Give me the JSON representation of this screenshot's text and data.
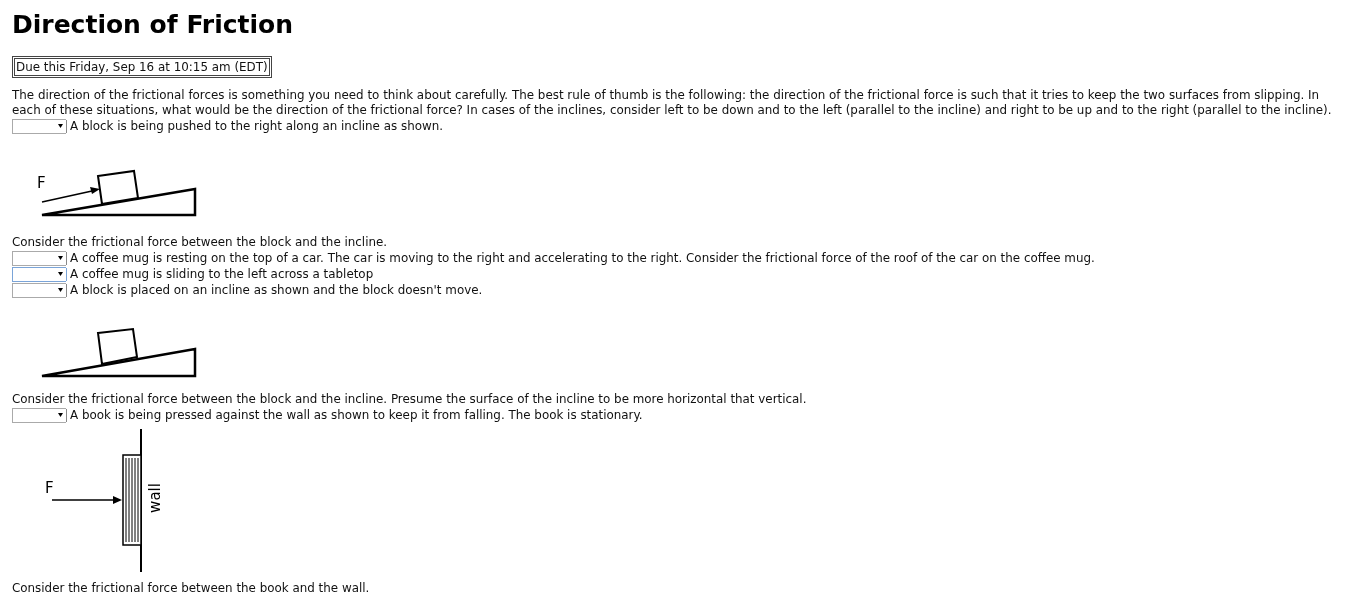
{
  "title": "Direction of Friction",
  "due": "Due this Friday, Sep 16 at 10:15 am (EDT)",
  "intro": "The direction of the frictional forces is something you need to think about carefully. The best rule of thumb is the following: the direction of the frictional force is such that it tries to keep the two surfaces from slipping. In each of these situations, what would be the direction of the frictional force? In cases of the inclines, consider left to be down and to the left (parallel to the incline) and right to be up and to the right (parallel to the incline).",
  "questions": [
    {
      "text": "A block is being pushed to the right along an incline as shown.",
      "focused": false,
      "figure": {
        "kind": "incline_push",
        "labels": [
          "F"
        ]
      },
      "note": "Consider the frictional force between the block and the incline."
    },
    {
      "text": "A coffee mug is resting on the top of a car. The car is moving to the right and accelerating to the right. Consider the frictional force of the roof of the car on the coffee mug.",
      "focused": false
    },
    {
      "text": "A coffee mug is sliding to the left across a tabletop",
      "focused": true
    },
    {
      "text": "A block is placed on an incline as shown and the block doesn't move.",
      "focused": false,
      "figure": {
        "kind": "incline_rest"
      },
      "note": "Consider the frictional force between the block and the incline. Presume the surface of the incline to be more horizontal that vertical."
    },
    {
      "text": "A book is being pressed against the wall as shown to keep it from falling. The book is stationary.",
      "focused": false,
      "figure": {
        "kind": "wall",
        "labels": [
          "F",
          "wall"
        ]
      },
      "note": "Consider the frictional force between the book and the wall."
    }
  ]
}
